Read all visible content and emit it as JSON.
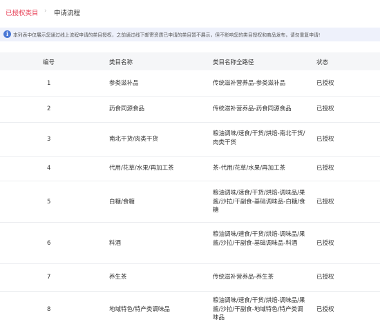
{
  "tabs": {
    "active": "已授权类目",
    "separator": "›",
    "inactive": "申请流程"
  },
  "notice": {
    "icon": "info-icon",
    "text": "本列表中仅展示您通过线上流程申请的类目授权，之前通过线下邮寄资质已申请的类目暂不展示，但不影响您的类目授权和商品发布，请勿重复申请!"
  },
  "table": {
    "headers": [
      "编号",
      "类目名称",
      "类目名称全路径",
      "状态"
    ],
    "rows": [
      {
        "num": "1",
        "name": "参类滋补品",
        "path": "传统滋补营养品-参类滋补品",
        "status": "已授权"
      },
      {
        "num": "2",
        "name": "药食同源食品",
        "path": "传统滋补营养品-药食同源食品",
        "status": "已授权"
      },
      {
        "num": "3",
        "name": "南北干货/肉类干货",
        "path": "粮油调味/速食/干货/烘焙-南北干货/肉类干货",
        "status": "已授权"
      },
      {
        "num": "4",
        "name": "代用/花草/水果/再加工茶",
        "path": "茶-代用/花草/水果/再加工茶",
        "status": "已授权"
      },
      {
        "num": "5",
        "name": "白糖/食糖",
        "path": "粮油调味/速食/干货/烘焙-调味品/果酱/沙拉/干副食-基础调味品-白糖/食糖",
        "status": "已授权"
      },
      {
        "num": "6",
        "name": "料酒",
        "path": "粮油调味/速食/干货/烘焙-调味品/果酱/沙拉/干副食-基础调味品-料酒",
        "status": "已授权"
      },
      {
        "num": "7",
        "name": "养生茶",
        "path": "传统滋补营养品-养生茶",
        "status": "已授权"
      },
      {
        "num": "8",
        "name": "地域特色/特产类调味品",
        "path": "粮油调味/速食/干货/烘焙-调味品/果酱/沙拉/干副食-地域特色/特产类调味品",
        "status": "已授权"
      }
    ]
  }
}
